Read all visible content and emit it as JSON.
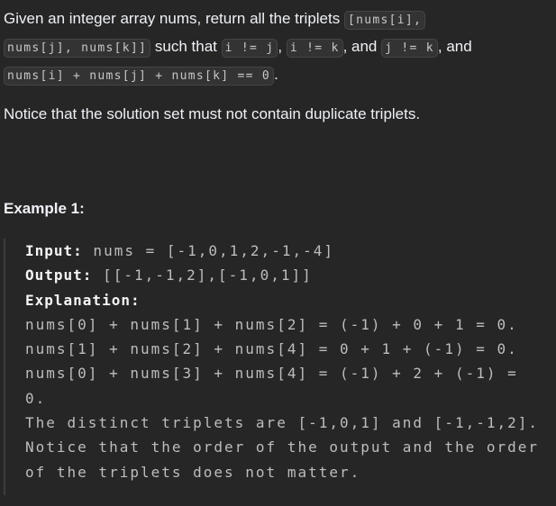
{
  "description": {
    "t1": "Given an integer array nums, return all the triplets ",
    "c1": "[nums[i],",
    "c2": "nums[j], nums[k]]",
    "t2": " such that ",
    "c3": "i != j",
    "t3": ", ",
    "c4": "i != k",
    "t4": ", and ",
    "c5": "j != k",
    "t5": ", and",
    "c6": "nums[i] + nums[j] + nums[k] == 0",
    "t6": ".",
    "notice": "Notice that the solution set must not contain duplicate triplets."
  },
  "example": {
    "title": "Example 1:",
    "input_label": "Input:",
    "input_value": " nums = [-1,0,1,2,-1,-4]",
    "output_label": "Output:",
    "output_value": " [[-1,-1,2],[-1,0,1]]",
    "explanation_label": "Explanation:",
    "explanation": "nums[0] + nums[1] + nums[2] = (-1) + 0 + 1 = 0.\nnums[1] + nums[2] + nums[4] = 0 + 1 + (-1) = 0.\nnums[0] + nums[3] + nums[4] = (-1) + 2 + (-1) = 0.\nThe distinct triplets are [-1,0,1] and [-1,-1,2].\nNotice that the order of the output and the order of the triplets does not matter."
  }
}
